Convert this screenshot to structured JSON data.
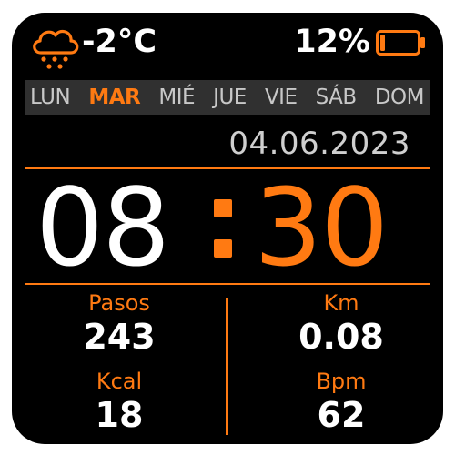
{
  "status": {
    "weather_icon": "snow-cloud-icon",
    "temperature": "-2°C",
    "battery_percent": "12%",
    "battery_icon": "battery-low-icon",
    "battery_level": 0.12
  },
  "weekdays": {
    "items": [
      "LUN",
      "MAR",
      "MIÉ",
      "JUE",
      "VIE",
      "SÁB",
      "DOM"
    ],
    "active": "MAR"
  },
  "date": "04.06.2023",
  "time": {
    "hours": "08",
    "minutes": "30"
  },
  "stats": {
    "steps": {
      "label": "Pasos",
      "value": "243"
    },
    "distance": {
      "label": "Km",
      "value": "0.08"
    },
    "calories": {
      "label": "Kcal",
      "value": "18"
    },
    "heart_rate": {
      "label": "Bpm",
      "value": "62"
    }
  },
  "colors": {
    "accent": "#ff7a12",
    "background": "#000000",
    "strip": "#303030"
  }
}
